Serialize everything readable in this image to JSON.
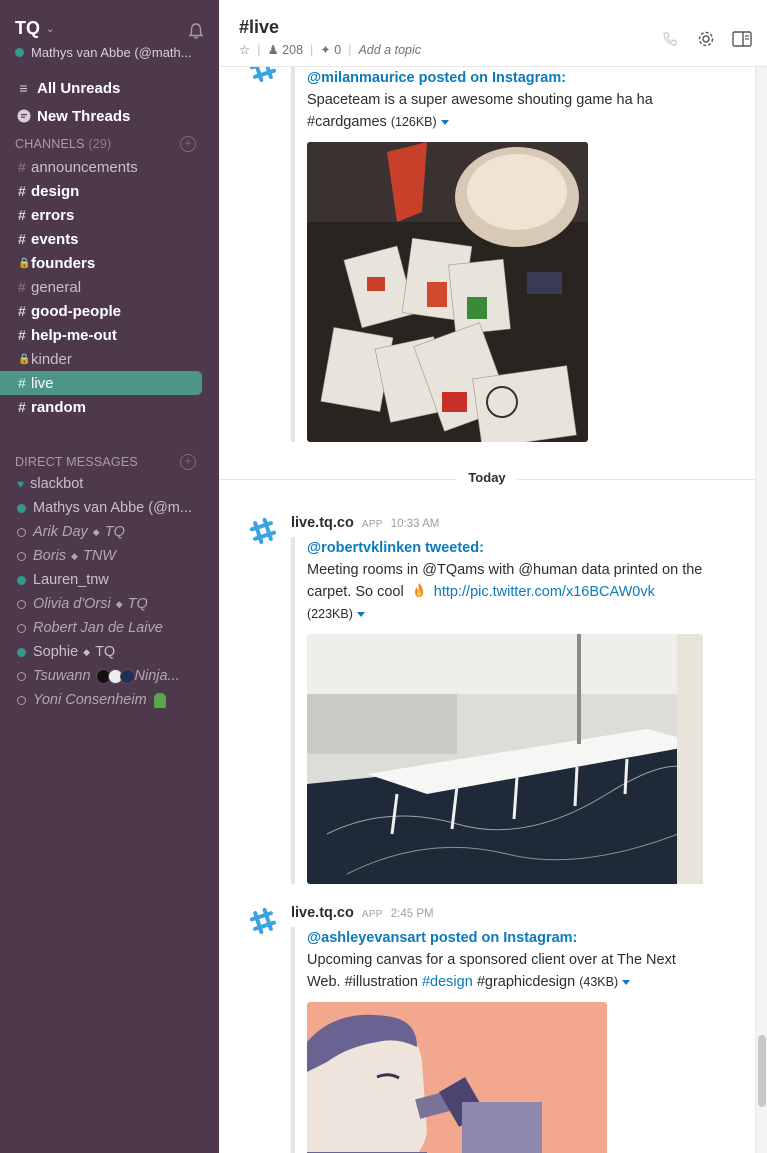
{
  "team": {
    "name": "TQ",
    "user": "Mathys van Abbe (@math..."
  },
  "nav": {
    "all_unreads": "All Unreads",
    "new_threads": "New Threads"
  },
  "channels": {
    "heading": "CHANNELS",
    "count": "(29)",
    "items": [
      {
        "name": "announcements",
        "prefix": "#",
        "state": "read"
      },
      {
        "name": "design",
        "prefix": "#",
        "state": "unread"
      },
      {
        "name": "errors",
        "prefix": "#",
        "state": "unread"
      },
      {
        "name": "events",
        "prefix": "#",
        "state": "unread"
      },
      {
        "name": "founders",
        "prefix": "lock",
        "state": "unread"
      },
      {
        "name": "general",
        "prefix": "#",
        "state": "read"
      },
      {
        "name": "good-people",
        "prefix": "#",
        "state": "unread"
      },
      {
        "name": "help-me-out",
        "prefix": "#",
        "state": "unread"
      },
      {
        "name": "kinder",
        "prefix": "lock",
        "state": "read"
      },
      {
        "name": "live",
        "prefix": "#",
        "state": "active"
      },
      {
        "name": "random",
        "prefix": "#",
        "state": "unread"
      }
    ]
  },
  "dms": {
    "heading": "DIRECT MESSAGES",
    "items": [
      {
        "name": "slackbot",
        "status": "heart",
        "italic": false
      },
      {
        "name": "Mathys van Abbe (@m...",
        "status": "online",
        "italic": false
      },
      {
        "name": "Arik Day",
        "org": "TQ",
        "status": "offline",
        "italic": true
      },
      {
        "name": "Boris",
        "org": "TNW",
        "status": "offline",
        "italic": true
      },
      {
        "name": "Lauren_tnw",
        "status": "online",
        "italic": false
      },
      {
        "name": "Olivia d'Orsi",
        "org": "TQ",
        "status": "offline",
        "italic": true
      },
      {
        "name": "Robert Jan de Laive",
        "status": "offline",
        "italic": true
      },
      {
        "name": "Sophie",
        "org": "TQ",
        "status": "online",
        "italic": false
      },
      {
        "name": "Tsuwann",
        "suffix": "Ninja...",
        "status": "offline",
        "italic": true
      },
      {
        "name": "Yoni Consenheim",
        "status": "offline",
        "italic": true
      }
    ]
  },
  "header": {
    "channel": "#live",
    "members": "208",
    "pins": "0",
    "topic": "Add a topic"
  },
  "day_divider": "Today",
  "messages": [
    {
      "author_line": "@milanmaurice posted on Instagram:",
      "text": "Spaceteam is a super awesome shouting game ha ha #cardgames",
      "size": "(126KB)"
    },
    {
      "sender": "live.tq.co",
      "badge": "APP",
      "time": "10:33 AM",
      "author_line": "@robertvklinken tweeted:",
      "text": "Meeting rooms in @TQams with @human data printed on the carpet. So cool",
      "link": "http://pic.twitter.com/x16BCAW0vk",
      "size": "(223KB)"
    },
    {
      "sender": "live.tq.co",
      "badge": "APP",
      "time": "2:45 PM",
      "author_line": "@ashleyevansart posted on Instagram:",
      "text_a": "Upcoming canvas for a sponsored client over at The Next Web. #illustration",
      "hashtag": "#design",
      "text_b": "#graphicdesign",
      "size": "(43KB)"
    }
  ],
  "colors": {
    "sidebar_bg": "#4d394b",
    "active_channel": "#4c9689",
    "presence_online": "#38978d",
    "link": "#0b7bbb"
  }
}
